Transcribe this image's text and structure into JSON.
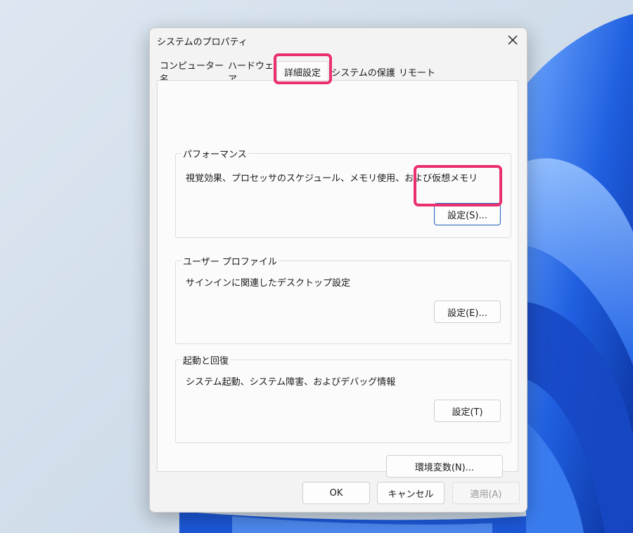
{
  "window": {
    "title": "システムのプロパティ",
    "close_icon": "close-icon"
  },
  "tabs": [
    {
      "label": "コンピューター名",
      "selected": false
    },
    {
      "label": "ハードウェア",
      "selected": false
    },
    {
      "label": "詳細設定",
      "selected": true
    },
    {
      "label": "システムの保護",
      "selected": false
    },
    {
      "label": "リモート",
      "selected": false
    }
  ],
  "groups": {
    "performance": {
      "label": "パフォーマンス",
      "description": "視覚効果、プロセッサのスケジュール、メモリ使用、および仮想メモリ",
      "button": "設定(S)..."
    },
    "user_profile": {
      "label": "ユーザー プロファイル",
      "description": "サインインに関連したデスクトップ設定",
      "button": "設定(E)..."
    },
    "startup_recovery": {
      "label": "起動と回復",
      "description": "システム起動、システム障害、およびデバッグ情報",
      "button": "設定(T)"
    }
  },
  "env_button": "環境変数(N)...",
  "footer": {
    "ok": "OK",
    "cancel": "キャンセル",
    "apply": "適用(A)"
  },
  "colors": {
    "highlight": "#ea2f6e",
    "wallpaper_blue": "#1f5fe0"
  }
}
